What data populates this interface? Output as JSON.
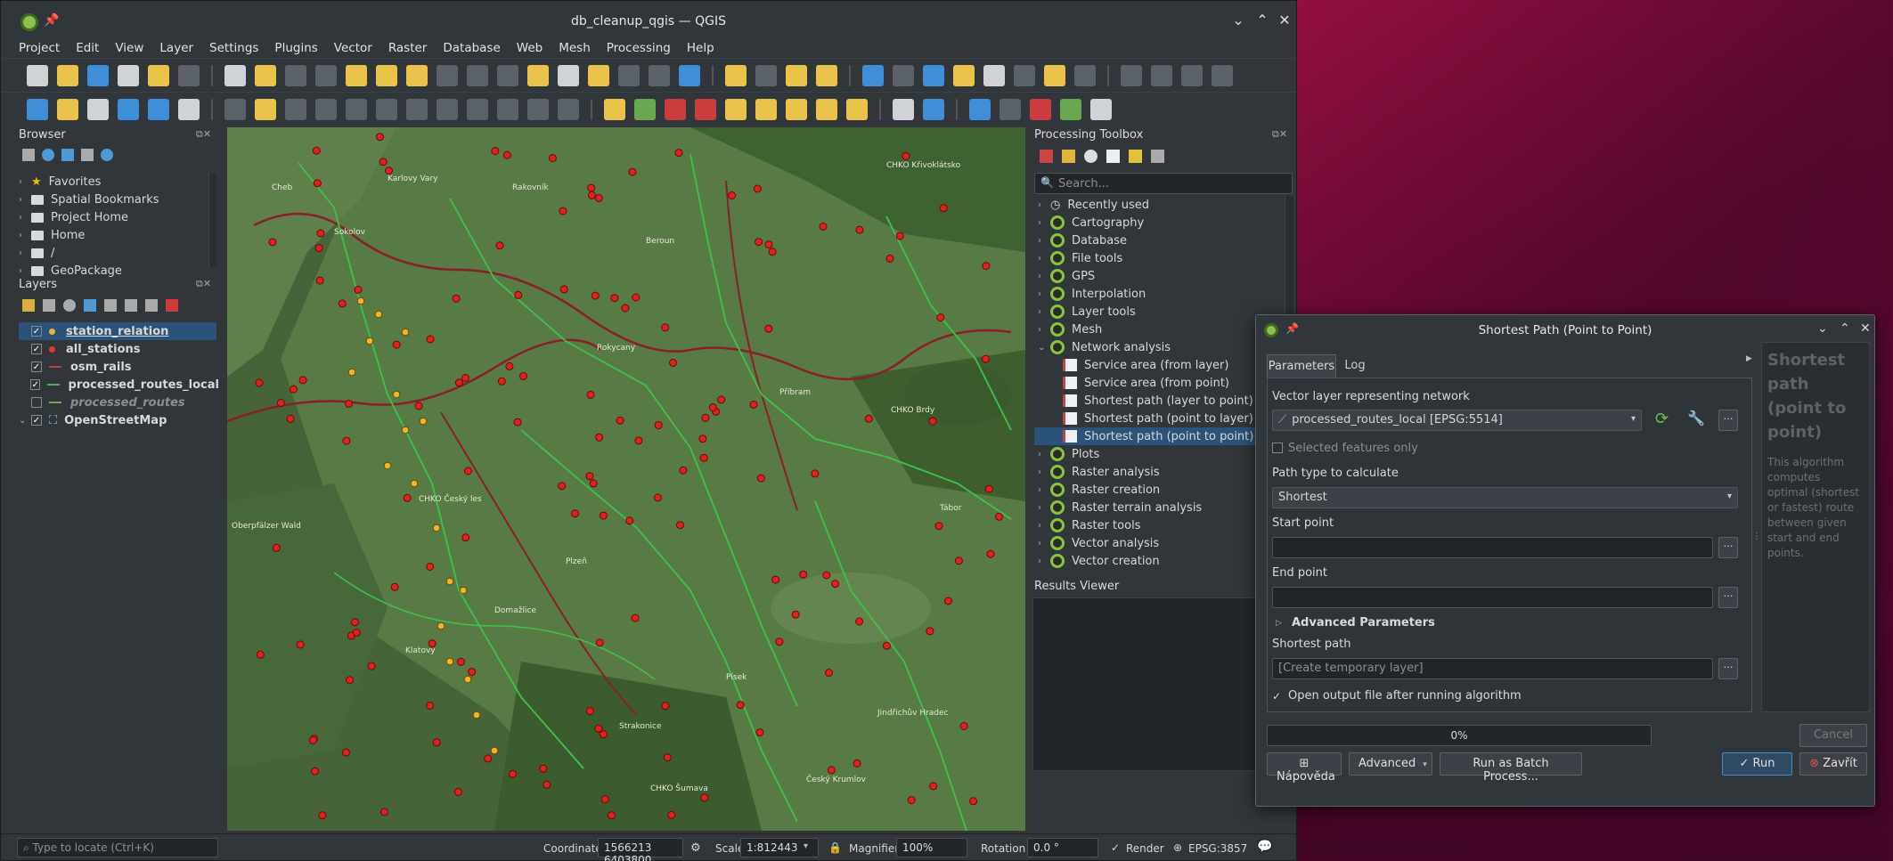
{
  "window": {
    "title": "db_cleanup_qgis — QGIS"
  },
  "menu": [
    "Project",
    "Edit",
    "View",
    "Layer",
    "Settings",
    "Plugins",
    "Vector",
    "Raster",
    "Database",
    "Web",
    "Mesh",
    "Processing",
    "Help"
  ],
  "browser": {
    "title": "Browser",
    "items": [
      {
        "label": "Favorites",
        "icon": "star-icon"
      },
      {
        "label": "Spatial Bookmarks",
        "icon": "bookmark-icon"
      },
      {
        "label": "Project Home",
        "icon": "folder-icon"
      },
      {
        "label": "Home",
        "icon": "folder-icon"
      },
      {
        "label": "/",
        "icon": "folder-icon"
      },
      {
        "label": "GeoPackage",
        "icon": "geopackage-icon"
      }
    ]
  },
  "layers": {
    "title": "Layers",
    "items": [
      {
        "label": "station_relation",
        "type": "point",
        "color": "#e8b23a",
        "checked": true,
        "selected": true
      },
      {
        "label": "all_stations",
        "type": "point",
        "color": "#e8342f",
        "checked": true
      },
      {
        "label": "osm_rails",
        "type": "line",
        "color": "#c23b3b",
        "checked": true
      },
      {
        "label": "processed_routes_local",
        "type": "line",
        "color": "#4caf50",
        "checked": true
      },
      {
        "label": "processed_routes",
        "type": "line",
        "color": "#7aa060",
        "checked": false
      },
      {
        "label": "OpenStreetMap",
        "type": "raster",
        "checked": true
      }
    ]
  },
  "map_labels": [
    "CHKO Křivoklátsko",
    "CHKO Brdy",
    "CHKO Český les",
    "CHKO Šumava",
    "Oberpfälzer Wald",
    "Rokycany",
    "Plzeň",
    "Příbram",
    "Klatovy",
    "Domažlice",
    "Strakonice",
    "Písek",
    "Tábor",
    "Jindřichův Hradec",
    "Český Krumlov",
    "Cheb",
    "Sokolov",
    "Karlovy Vary",
    "Rakovník",
    "Beroun"
  ],
  "toolbox": {
    "title": "Processing Toolbox",
    "search_placeholder": "Search...",
    "items": [
      {
        "label": "Recently used",
        "icon": "clock-icon",
        "expanded": false
      },
      {
        "label": "Cartography",
        "icon": "qgis-icon"
      },
      {
        "label": "Database",
        "icon": "qgis-icon"
      },
      {
        "label": "File tools",
        "icon": "qgis-icon"
      },
      {
        "label": "GPS",
        "icon": "qgis-icon"
      },
      {
        "label": "Interpolation",
        "icon": "qgis-icon"
      },
      {
        "label": "Layer tools",
        "icon": "qgis-icon"
      },
      {
        "label": "Mesh",
        "icon": "qgis-icon"
      },
      {
        "label": "Network analysis",
        "icon": "qgis-icon",
        "expanded": true
      },
      {
        "label": "Service area (from layer)",
        "child": true
      },
      {
        "label": "Service area (from point)",
        "child": true
      },
      {
        "label": "Shortest path (layer to point)",
        "child": true
      },
      {
        "label": "Shortest path (point to layer)",
        "child": true
      },
      {
        "label": "Shortest path (point to point)",
        "child": true,
        "selected": true
      },
      {
        "label": "Plots",
        "icon": "qgis-icon"
      },
      {
        "label": "Raster analysis",
        "icon": "qgis-icon"
      },
      {
        "label": "Raster creation",
        "icon": "qgis-icon"
      },
      {
        "label": "Raster terrain analysis",
        "icon": "qgis-icon"
      },
      {
        "label": "Raster tools",
        "icon": "qgis-icon"
      },
      {
        "label": "Vector analysis",
        "icon": "qgis-icon"
      },
      {
        "label": "Vector creation",
        "icon": "qgis-icon"
      }
    ]
  },
  "results_viewer": {
    "title": "Results Viewer"
  },
  "status": {
    "locate_placeholder": "Type to locate (Ctrl+K)",
    "coordinate_label": "Coordinate",
    "coordinate": "1566213 6403800",
    "scale_label": "Scale",
    "scale": "1:812443",
    "magnifier_label": "Magnifier",
    "magnifier": "100%",
    "rotation_label": "Rotation",
    "rotation": "0.0 °",
    "render_label": "Render",
    "crs": "EPSG:3857"
  },
  "dialog": {
    "title": "Shortest Path (Point to Point)",
    "tabs": [
      "Parameters",
      "Log"
    ],
    "network_label": "Vector layer representing network",
    "network_value": "processed_routes_local [EPSG:5514]",
    "selected_features": "Selected features only",
    "path_type_label": "Path type to calculate",
    "path_type_value": "Shortest",
    "start_label": "Start point",
    "end_label": "End point",
    "advanced_label": "Advanced Parameters",
    "output_label": "Shortest path",
    "output_value": "[Create temporary layer]",
    "open_output": "Open output file after running algorithm",
    "progress_text": "0%",
    "progress": 0,
    "cancel": "Cancel",
    "help_btn": "Nápověda",
    "advanced_btn": "Advanced",
    "batch_btn": "Run as Batch Process...",
    "run_btn": "Run",
    "close_btn": "Zavřít",
    "help_title": "Shortest path (point to point)",
    "help_text": "This algorithm computes optimal (shortest or fastest) route between given start and end points."
  }
}
